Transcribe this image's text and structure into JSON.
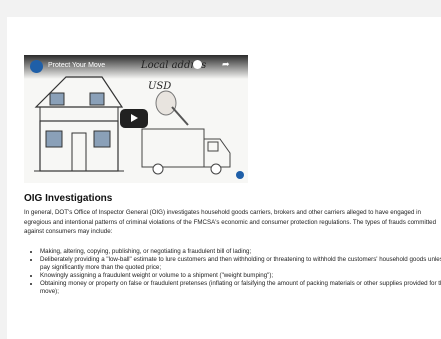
{
  "video": {
    "title": "Protect Your Move",
    "whiteboard_text_1": "Local addres",
    "whiteboard_text_2": "USD"
  },
  "section": {
    "heading": "OIG Investigations",
    "intro": "In general, DOT's Office of Inspector General (OIG) investigates household goods carriers, brokers and other carriers alleged to have engaged in egregious and intentional patterns of criminal violations of the FMCSA's economic and consumer protection regulations. The types of frauds committed against consumers may include:",
    "items": [
      "Making, altering, copying, publishing, or negotiating a fraudulent bill of lading;",
      "Deliberately providing a \"low-ball\" estimate to lure customers and then withholding or threatening to withhold the customers' household goods unless they pay significantly more than the quoted price;",
      "Knowingly assigning a fraudulent weight or volume to a shipment (\"weight bumping\");",
      "Obtaining money or property on false or fraudulent pretenses (inflating or falsifying the amount of packing materials or other supplies provided for the move);"
    ]
  }
}
